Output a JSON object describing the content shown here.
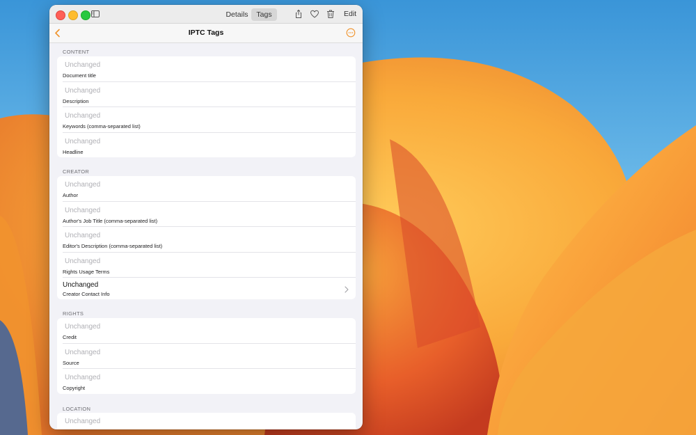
{
  "window": {
    "segments": {
      "details": "Details",
      "tags": "Tags"
    },
    "edit_label": "Edit",
    "icons": [
      "sidebar-icon",
      "share-icon",
      "heart-icon",
      "trash-icon"
    ]
  },
  "navbar": {
    "title": "IPTC Tags",
    "accent_color": "#f0932b"
  },
  "sections": {
    "content": {
      "header": "CONTENT",
      "rows": [
        {
          "value": "Unchanged",
          "label": "Document title"
        },
        {
          "value": "Unchanged",
          "label": "Description"
        },
        {
          "value": "Unchanged",
          "label": "Keywords (comma-separated list)"
        },
        {
          "value": "Unchanged",
          "label": "Headline"
        }
      ]
    },
    "creator": {
      "header": "CREATOR",
      "rows": [
        {
          "value": "Unchanged",
          "label": "Author"
        },
        {
          "value": "Unchanged",
          "label": "Author's Job Title (comma-separated list)"
        },
        {
          "value": "Unchanged",
          "label": "Editor's Description (comma-separated list)"
        },
        {
          "value": "Unchanged",
          "label": "Rights Usage Terms"
        },
        {
          "value": "Unchanged",
          "label": "Creator Contact Info"
        }
      ]
    },
    "rights": {
      "header": "RIGHTS",
      "rows": [
        {
          "value": "Unchanged",
          "label": "Credit"
        },
        {
          "value": "Unchanged",
          "label": "Source"
        },
        {
          "value": "Unchanged",
          "label": "Copyright"
        }
      ]
    },
    "location": {
      "header": "LOCATION",
      "rows": [
        {
          "value": "Unchanged",
          "label": ""
        }
      ]
    }
  }
}
